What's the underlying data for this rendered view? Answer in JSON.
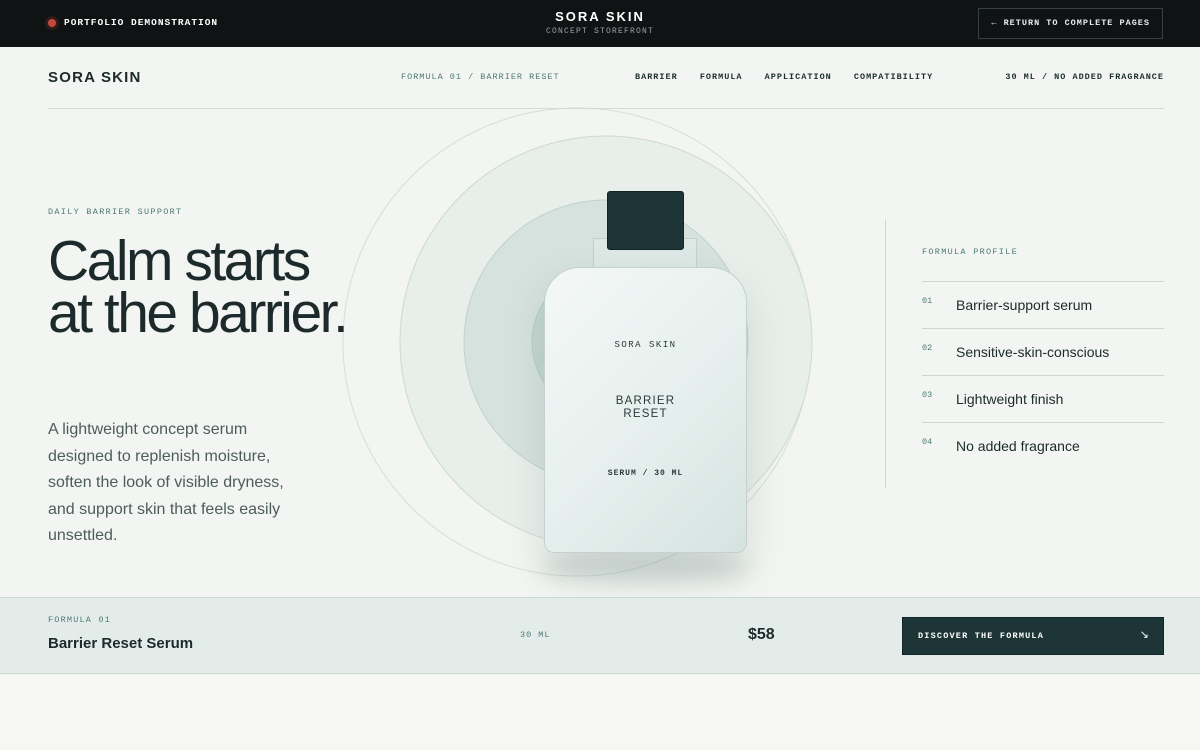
{
  "topbar": {
    "demo_label": "PORTFOLIO DEMONSTRATION",
    "brand": "SORA SKIN",
    "subtitle": "CONCEPT STOREFRONT",
    "return_label": "← RETURN TO COMPLETE PAGES"
  },
  "nav": {
    "logo": "SORA SKIN",
    "breadcrumb": "FORMULA 01 / BARRIER RESET",
    "links": [
      "BARRIER",
      "FORMULA",
      "APPLICATION",
      "COMPATIBILITY"
    ],
    "meta": "30 ML / NO ADDED FRAGRANCE"
  },
  "hero": {
    "eyebrow": "DAILY BARRIER SUPPORT",
    "headline": "Calm starts at the barrier.",
    "lede": "A lightweight concept serum designed to replenish moisture, soften the look of visible dryness, and support skin that feels easily unsettled."
  },
  "bottle": {
    "brand": "SORA SKIN",
    "name_line1": "BARRIER",
    "name_line2": "RESET",
    "size": "SERUM / 30 ML"
  },
  "profile": {
    "title": "FORMULA PROFILE",
    "items": [
      {
        "num": "01",
        "label": "Barrier-support serum"
      },
      {
        "num": "02",
        "label": "Sensitive-skin-conscious"
      },
      {
        "num": "03",
        "label": "Lightweight finish"
      },
      {
        "num": "04",
        "label": "No added fragrance"
      }
    ]
  },
  "product_bar": {
    "formula_label": "FORMULA 01",
    "product_name": "Barrier Reset Serum",
    "size": "30 ML",
    "price": "$58",
    "cta_label": "DISCOVER THE FORMULA",
    "cta_arrow": "↘"
  },
  "colors": {
    "dark": "#0f1314",
    "accent_teal": "#1d3536",
    "muted_teal": "#4e7a76",
    "status_dot": "#c8493b",
    "background": "#f2f5f1",
    "bar_background": "#e4ecea"
  }
}
